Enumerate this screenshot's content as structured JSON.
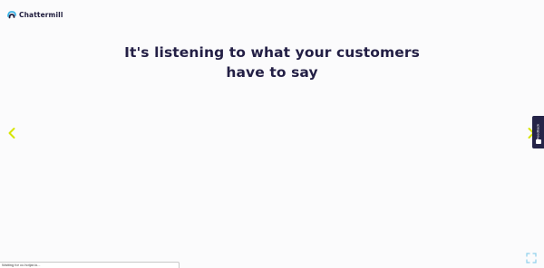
{
  "brand": {
    "name": "Chattermill",
    "logo_color": "#3ab3e6"
  },
  "hero": {
    "headline_line1": "It's listening to what your customers",
    "headline_line2": "have to say",
    "text_color": "#231f45"
  },
  "carousel": {
    "prev_icon": "chevron-left-icon",
    "next_icon": "chevron-right-icon",
    "arrow_color": "#d7e500"
  },
  "feedback": {
    "label": "Feedback",
    "background": "#252448"
  },
  "controls": {
    "fullscreen_icon": "fullscreen-icon",
    "icon_color": "#8fd0ec"
  },
  "status": {
    "text": "Waiting for cc.hotjar.io..."
  }
}
